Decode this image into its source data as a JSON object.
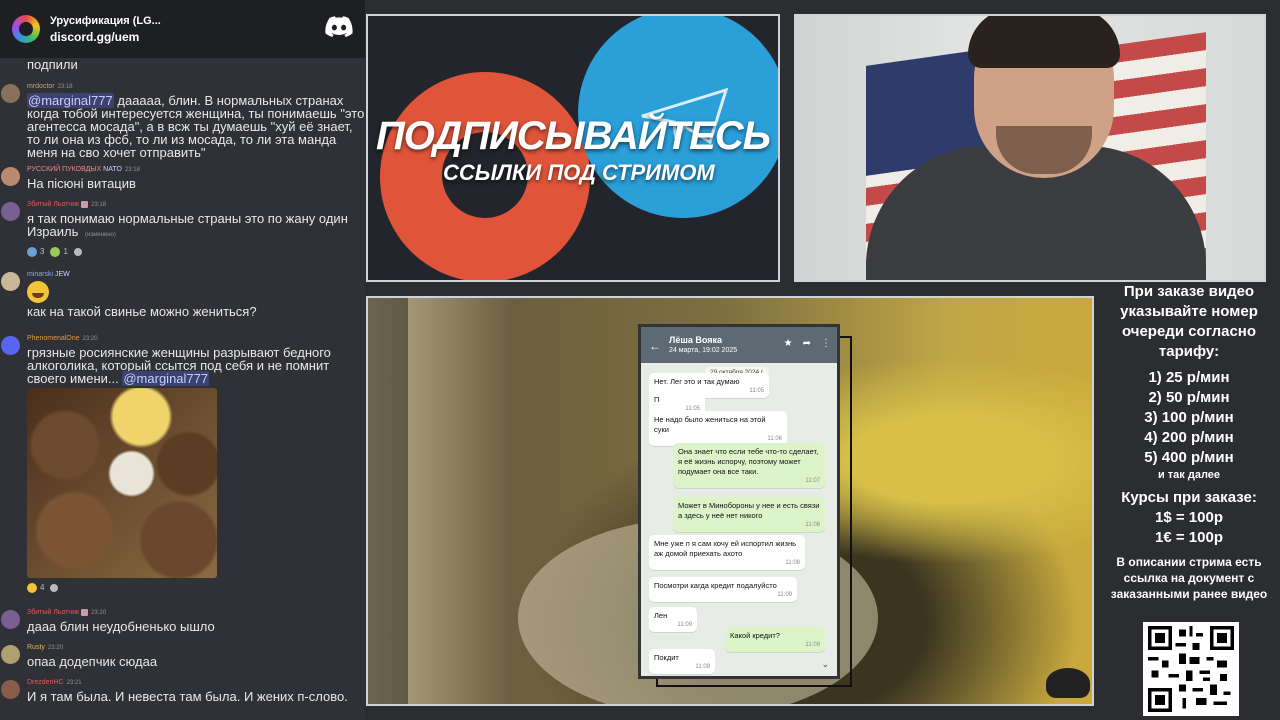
{
  "discord": {
    "server_name": "Урусификация (LG...",
    "server_link": "discord.gg/uem"
  },
  "messages": [
    {
      "author": "",
      "time": "",
      "text": "подпили"
    },
    {
      "author": "mrdoctor",
      "time": "23:18",
      "mention": "@marginal777",
      "text": "дааааа, блин. В нормальных странах когда тобой интересуется женщина, ты понимаешь \"это агентесса мосада\", а в всж ты думаешь \"хуй её знает, то ли она из фсб, то ли из мосада, то ли эта манда меня на сво хочет отправить\""
    },
    {
      "author": "РУССКИЙ ПУКОВДЫХ",
      "badge": "NATO",
      "time": "23:18",
      "text": "На пісюні витацив"
    },
    {
      "author": "Збитый Льотчик",
      "time": "23:18",
      "text": "я так понимаю нормальные страны это по жану один Израиль",
      "edited": "(изменено)",
      "reactions": [
        "3",
        "1"
      ]
    },
    {
      "author": "minarski",
      "badge": "JEW",
      "time": "23:19",
      "text": "как на такой свинье можно жениться?"
    },
    {
      "author": "PhenomenalOne",
      "time": "23:20",
      "text": "грязные росиянские женщины разрывают бедного алкоголика, который ссытся под себя и не помнит своего имени...",
      "mention": "@marginal777",
      "reactions": [
        "4"
      ]
    },
    {
      "author": "Збитый Льотчик",
      "time": "23:20",
      "text": "дааа блин неудобненько  ышло"
    },
    {
      "author": "Rusty",
      "time": "23:20",
      "text": "опаа додепчик сюдаа"
    },
    {
      "author": "DrezdenHC",
      "time": "23:21",
      "text": "И я там была. И невеста там была. И жених п-слово."
    }
  ],
  "banner": {
    "title": "ПОДПИСЫВАЙТЕСЬ",
    "subtitle": "ССЫЛКИ ПОД СТРИМОМ"
  },
  "phone": {
    "contact": "Лёша Вояка",
    "date": "24 марта, 19:02 2025",
    "day": "29 октября 2024 г.",
    "bubbles": [
      {
        "dir": "in",
        "text": "Нет. Лег это и так думаю",
        "time": "11:05"
      },
      {
        "dir": "in",
        "text": "П",
        "time": "11:05"
      },
      {
        "dir": "in",
        "text": "Не надо было жениться на этой суки",
        "time": "11:06"
      },
      {
        "dir": "out",
        "text": "Она знает что если тебе что-то сделает, я её жизнь испорчу, поэтому может подумает она все таки.",
        "time": "11:07"
      },
      {
        "dir": "out",
        "text": "Может в Минобороны у нее и есть связи а здесь у неё нет никого",
        "time": "11:08"
      },
      {
        "dir": "in",
        "text": "Мне уже п   я сам хочу ей испортил жизнь аж домой приехать ахото",
        "time": "11:08"
      },
      {
        "dir": "in",
        "text": "Посмотри кагда кредит подалуйсто",
        "time": "11:09"
      },
      {
        "dir": "in",
        "text": "Лен",
        "time": "11:09"
      },
      {
        "dir": "out",
        "text": "Какой кредит?",
        "time": "11:09"
      },
      {
        "dir": "in",
        "text": "Покдит",
        "time": "11:09"
      }
    ]
  },
  "info": {
    "order_heading": "При заказе видео указывайте номер очереди согласно тарифу:",
    "tariffs": [
      "1) 25 р/мин",
      "2) 50 р/мин",
      "3) 100 р/мин",
      "4) 200 р/мин",
      "5) 400 р/мин"
    ],
    "etc": "и так далее",
    "rates_heading": "Курсы при заказе:",
    "rates": [
      "1$ = 100р",
      "1€ = 100р"
    ],
    "note": "В описании стрима есть ссылка на документ с заказанными ранее видео"
  },
  "colors": {
    "accent_red": "#e0553a",
    "accent_blue": "#2a9fd8",
    "mention_bg": "#3c4270"
  }
}
